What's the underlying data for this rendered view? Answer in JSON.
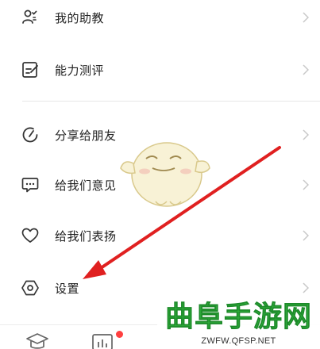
{
  "menu": {
    "items": [
      {
        "label": "我的助教",
        "icon": "assistant-person-icon"
      },
      {
        "label": "能力测评",
        "icon": "edit-note-icon"
      },
      {
        "label": "分享给朋友",
        "icon": "share-refresh-icon"
      },
      {
        "label": "给我们意见",
        "icon": "chat-bubble-icon"
      },
      {
        "label": "给我们表扬",
        "icon": "heart-icon"
      },
      {
        "label": "设置",
        "icon": "hexagon-settings-icon"
      }
    ]
  },
  "bottom_tabs": [
    {
      "icon": "graduation-cap-icon"
    },
    {
      "icon": "stats-bars-icon",
      "badge": true
    }
  ],
  "watermark": {
    "title": "曲阜手游网",
    "url": "ZWFW.QFSP.NET"
  },
  "annotation": {
    "arrow_color": "#e02020"
  },
  "colors": {
    "text": "#222222",
    "chevron": "#c8c8c8",
    "badge": "#ff4040",
    "watermark_green": "#2fae3b"
  }
}
